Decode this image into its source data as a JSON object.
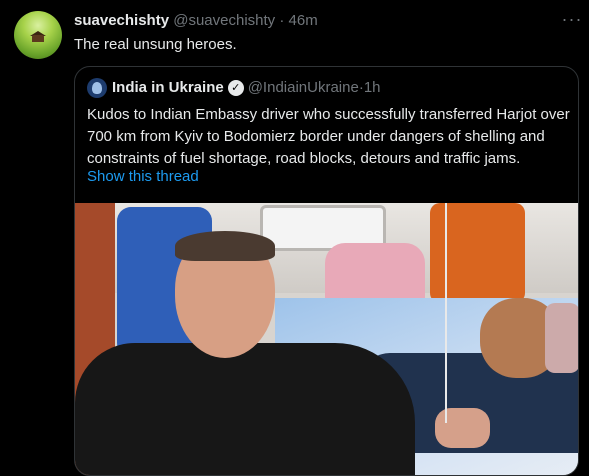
{
  "tweet": {
    "display_name": "suavechishty",
    "handle": "@suavechishty",
    "separator": "·",
    "time": "46m",
    "text": "The real unsung heroes.",
    "more_icon": "more-horizontal-icon"
  },
  "quote": {
    "display_name": "India in Ukraine",
    "handle": "@IndiainUkraine",
    "separator": "·",
    "time": "1h",
    "verified_icon": "verified-badge-icon",
    "text": "Kudos to Indian Embassy driver who successfully transferred Harjot over 700 km from Kyiv to Bodomierz border under dangers of shelling and constraints of fuel shortage, road blocks, detours and traffic jams.",
    "show_thread": "Show this thread"
  },
  "colors": {
    "background": "#000000",
    "text": "#e7e9ea",
    "muted": "#71767b",
    "link": "#1d9bf0",
    "border": "#2f3336"
  }
}
